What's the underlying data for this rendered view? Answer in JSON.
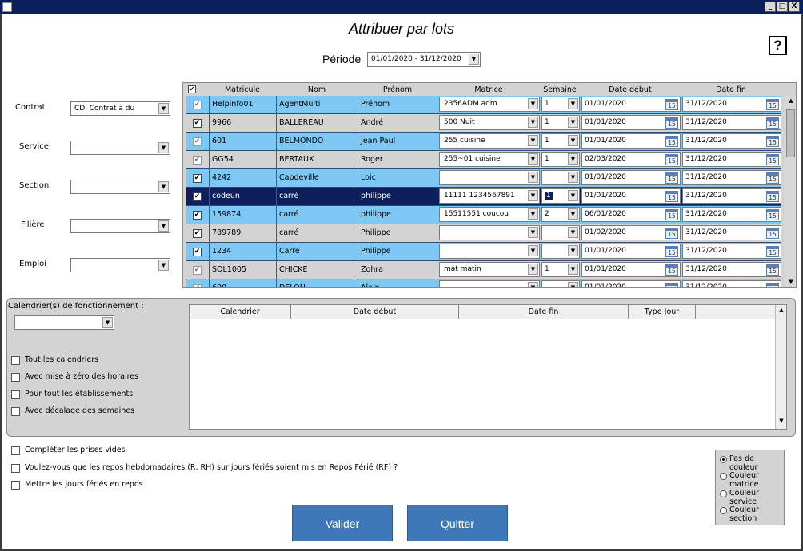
{
  "window": {
    "minimize": "_",
    "maximize": "□",
    "close": "X"
  },
  "title": "Attribuer par lots",
  "help": "?",
  "periode": {
    "label": "Période",
    "value": "01/01/2020 - 31/12/2020"
  },
  "filters": [
    {
      "label": "Contrat",
      "value": "CDI Contrat à du"
    },
    {
      "label": "Service",
      "value": ""
    },
    {
      "label": "Section",
      "value": ""
    },
    {
      "label": "Filière",
      "value": ""
    },
    {
      "label": "Emploi",
      "value": ""
    }
  ],
  "grid": {
    "columns": [
      "Matricule",
      "Nom",
      "Prénom",
      "Matrice",
      "Semaine",
      "Date début",
      "Date fin"
    ],
    "cal_day": "15",
    "rows": [
      {
        "matricule": "Helpinfo01",
        "nom": "AgentMulti",
        "prenom": "Prénom",
        "matrice": "2356ADM adm",
        "semaine": "1",
        "debut": "01/01/2020",
        "fin": "31/12/2020",
        "style": "blue",
        "check": "grey"
      },
      {
        "matricule": "9966",
        "nom": "BALLEREAU",
        "prenom": "André",
        "matrice": "500 Nuit",
        "semaine": "1",
        "debut": "01/01/2020",
        "fin": "31/12/2020",
        "style": "grey",
        "check": "dark"
      },
      {
        "matricule": "601",
        "nom": "BELMONDO",
        "prenom": "Jean Paul",
        "matrice": "255 cuisine",
        "semaine": "1",
        "debut": "01/01/2020",
        "fin": "31/12/2020",
        "style": "blue",
        "check": "grey"
      },
      {
        "matricule": "GG54",
        "nom": "BERTAUX",
        "prenom": "Roger",
        "matrice": "255~01 cuisine",
        "semaine": "1",
        "debut": "02/03/2020",
        "fin": "31/12/2020",
        "style": "grey",
        "check": "grey"
      },
      {
        "matricule": "4242",
        "nom": "Capdeville",
        "prenom": "Loic",
        "matrice": "",
        "semaine": "",
        "debut": "01/01/2020",
        "fin": "31/12/2020",
        "style": "blue",
        "check": "dark"
      },
      {
        "matricule": "codeun",
        "nom": "carré",
        "prenom": "philippe",
        "matrice": "11111 1234567891",
        "semaine": "1",
        "debut": "01/01/2020",
        "fin": "31/12/2020",
        "style": "sel",
        "check": "dark"
      },
      {
        "matricule": "159874",
        "nom": "carré",
        "prenom": "philippe",
        "matrice": "15511551 coucou",
        "semaine": "2",
        "debut": "06/01/2020",
        "fin": "31/12/2020",
        "style": "blue",
        "check": "dark"
      },
      {
        "matricule": "789789",
        "nom": "carré",
        "prenom": "Philippe",
        "matrice": "",
        "semaine": "",
        "debut": "01/02/2020",
        "fin": "31/12/2020",
        "style": "grey",
        "check": "dark"
      },
      {
        "matricule": "1234",
        "nom": "Carré",
        "prenom": "Philippe",
        "matrice": "",
        "semaine": "",
        "debut": "01/01/2020",
        "fin": "31/12/2020",
        "style": "blue",
        "check": "dark"
      },
      {
        "matricule": "SOL1005",
        "nom": "CHICKE",
        "prenom": "Zohra",
        "matrice": "mat matin",
        "semaine": "1",
        "debut": "01/01/2020",
        "fin": "31/12/2020",
        "style": "grey",
        "check": "grey"
      },
      {
        "matricule": "600",
        "nom": "DELON",
        "prenom": "Alain",
        "matrice": "",
        "semaine": "",
        "debut": "01/01/2020",
        "fin": "31/12/2020",
        "style": "blue",
        "check": "grey"
      }
    ]
  },
  "calendriers": {
    "label": "Calendrier(s) de fonctionnement :",
    "columns": [
      "Calendrier",
      "Date début",
      "Date fin",
      "Type Jour"
    ],
    "options": [
      "Tout les calendriers",
      "Avec mise à zéro des horaires",
      "Pour tout les établissements",
      "Avec décalage des semaines"
    ]
  },
  "bottom_options": [
    "Compléter les prises vides",
    "Voulez-vous que les repos hebdomadaires (R, RH) sur jours fériés soient mis en Repos Férié (RF) ?",
    "Mettre les jours fériés en repos"
  ],
  "colors": {
    "label": "",
    "options": [
      "Pas de couleur",
      "Couleur matrice",
      "Couleur service",
      "Couleur section"
    ],
    "selected": 0
  },
  "buttons": {
    "valider": "Valider",
    "quitter": "Quitter"
  },
  "palette": {
    "row_blue": "#7ec8f5",
    "row_grey": "#d3d3d3",
    "row_sel": "#0d1f5c",
    "titlebar": "#0b1f5e",
    "button": "#3f78b8"
  }
}
